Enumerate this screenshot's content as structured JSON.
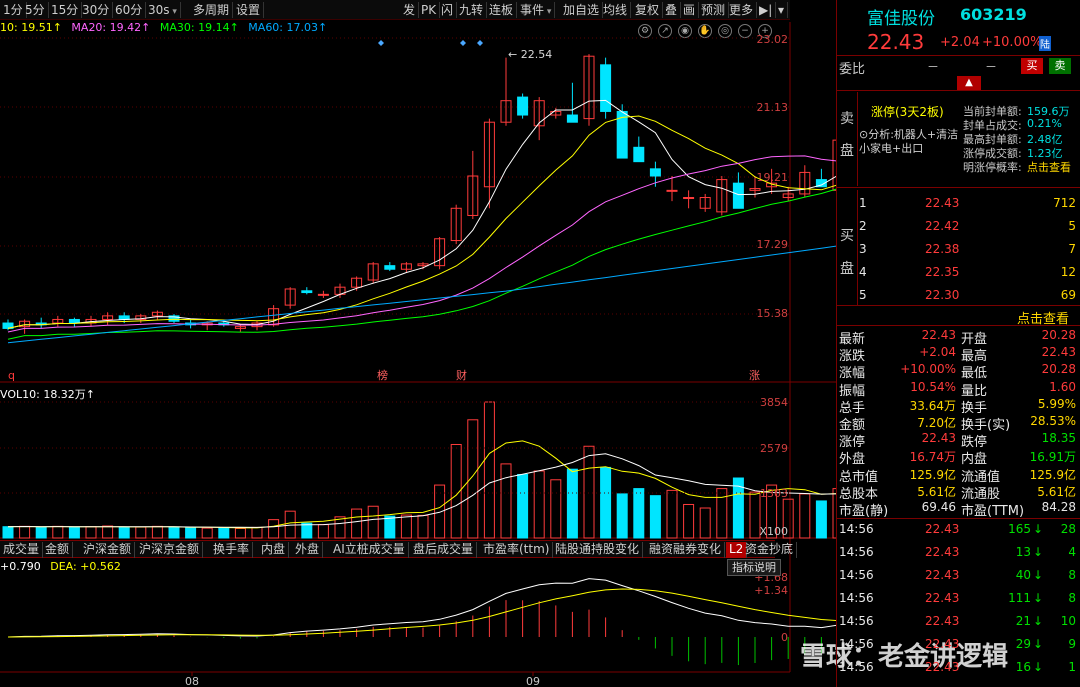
{
  "toolbar": {
    "items": [
      "1分",
      "5分",
      "15分",
      "30分",
      "60分",
      "30s",
      "多周期",
      "设置",
      "发",
      "PK",
      "闪",
      "九转",
      "连板",
      "事件",
      "加自选",
      "均线",
      "复权",
      "叠",
      "画",
      "预测",
      "更多"
    ],
    "right_icons": [
      "arrow-icon",
      "dropdown-icon"
    ]
  },
  "ma": {
    "ma10": "10: 19.51↑",
    "ma20": "MA20: 19.42↑",
    "ma30": "MA30: 19.14↑",
    "ma60": "MA60: 17.03↑"
  },
  "colors": {
    "up": "#ff3b3b",
    "down": "#00e5ff",
    "ma5": "#ffffff",
    "ma10": "#ffff00",
    "ma20": "#ff66ff",
    "ma30": "#00ff00",
    "ma60": "#00aaff",
    "grid": "#5a0000"
  },
  "price_axis": [
    "23.02",
    "21.13",
    "19.21",
    "17.29",
    "15.38"
  ],
  "peak_label": "22.54",
  "markers": [
    {
      "text": "q",
      "color": "#ff3b3b"
    },
    {
      "text": "榜",
      "color": "#ff6060"
    },
    {
      "text": "财",
      "color": "#ff6060"
    },
    {
      "text": "涨",
      "color": "#ff6060"
    }
  ],
  "vol": {
    "legend": "VOL10: 18.32万↑",
    "axis": [
      "3854",
      "2579",
      "1303",
      "X100"
    ]
  },
  "tabs": [
    "成交量",
    "金额",
    "沪深金额",
    "沪深京金额",
    "换手率",
    "内盘",
    "外盘",
    "AI立桩成交量",
    "盘后成交量",
    "市盈率(ttm)",
    "陆股通持股变化",
    "融资融券变化",
    "L2",
    "资金抄底"
  ],
  "macd": {
    "legend_dif": "+0.790",
    "legend_dea": "DEA: +0.562",
    "axis": [
      "+1.68",
      "+1.34",
      "0"
    ],
    "indicator_btn": "指标说明"
  },
  "x_labels": [
    "08",
    "09"
  ],
  "watermark": "雪球：老金讲逻辑",
  "stock": {
    "name": "富佳股份",
    "code": "603219",
    "price": "22.43",
    "change": "+2.04",
    "pct": "+10.00%",
    "market": "陆"
  },
  "weibi": {
    "label": "委比",
    "v1": "－",
    "v2": "－",
    "buy": "买",
    "sell": "卖"
  },
  "limit": {
    "side_top": "卖",
    "side_bot": "盘",
    "status": "涨停(3天2板)",
    "analysis": "分析:机器人+清洁小家电+出口",
    "fields": [
      [
        "当前封单额:",
        "159.6万"
      ],
      [
        "封单占成交:",
        "0.21%"
      ],
      [
        "最高封单额:",
        "2.48亿"
      ],
      [
        "涨停成交额:",
        "1.23亿"
      ],
      [
        "明涨停概率:",
        "点击查看"
      ]
    ]
  },
  "bids": [
    [
      "1",
      "22.43",
      "712"
    ],
    [
      "2",
      "22.42",
      "5"
    ],
    [
      "3",
      "22.38",
      "7"
    ],
    [
      "4",
      "22.35",
      "12"
    ],
    [
      "5",
      "22.30",
      "69"
    ]
  ],
  "bid_side": [
    "买",
    "盘"
  ],
  "click_view": "点击查看",
  "quote": [
    [
      "最新",
      "22.43",
      "开盘",
      "20.28"
    ],
    [
      "涨跌",
      "+2.04",
      "最高",
      "22.43"
    ],
    [
      "涨幅",
      "+10.00%",
      "最低",
      "20.28"
    ],
    [
      "振幅",
      "10.54%",
      "量比",
      "1.60"
    ],
    [
      "总手",
      "33.64万",
      "换手",
      "5.99%"
    ],
    [
      "金额",
      "7.20亿",
      "换手(实)",
      "28.53%"
    ],
    [
      "涨停",
      "22.43",
      "跌停",
      "18.35"
    ],
    [
      "外盘",
      "16.74万",
      "内盘",
      "16.91万"
    ],
    [
      "总市值",
      "125.9亿",
      "流通值",
      "125.9亿"
    ],
    [
      "总股本",
      "5.61亿",
      "流通股",
      "5.61亿"
    ],
    [
      "市盈(静)",
      "69.46",
      "市盈(TTM)",
      "84.28"
    ]
  ],
  "ticks": [
    [
      "14:56",
      "22.43",
      "165",
      "28"
    ],
    [
      "14:56",
      "22.43",
      "13",
      "4"
    ],
    [
      "14:56",
      "22.43",
      "40",
      "8"
    ],
    [
      "14:56",
      "22.43",
      "111",
      "8"
    ],
    [
      "14:56",
      "22.43",
      "21",
      "10"
    ],
    [
      "14:56",
      "22.43",
      "29",
      "9"
    ],
    [
      "14:56",
      "22.43",
      "16",
      "1"
    ]
  ]
}
